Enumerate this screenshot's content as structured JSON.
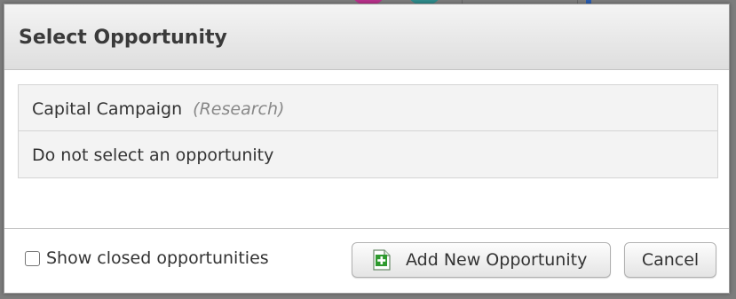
{
  "dialog": {
    "title": "Select Opportunity"
  },
  "options": [
    {
      "name": "Capital Campaign",
      "status": "(Research)"
    },
    {
      "name": "Do not select an opportunity",
      "status": ""
    }
  ],
  "footer": {
    "show_closed_label": "Show closed opportunities",
    "show_closed_checked": false,
    "add_button_label": "Add New Opportunity",
    "add_button_icon": "document-add-icon",
    "cancel_button_label": "Cancel"
  },
  "colors": {
    "icon_green": "#2e9a2e",
    "header_text": "#3a3a3a",
    "status_text": "#888888"
  }
}
